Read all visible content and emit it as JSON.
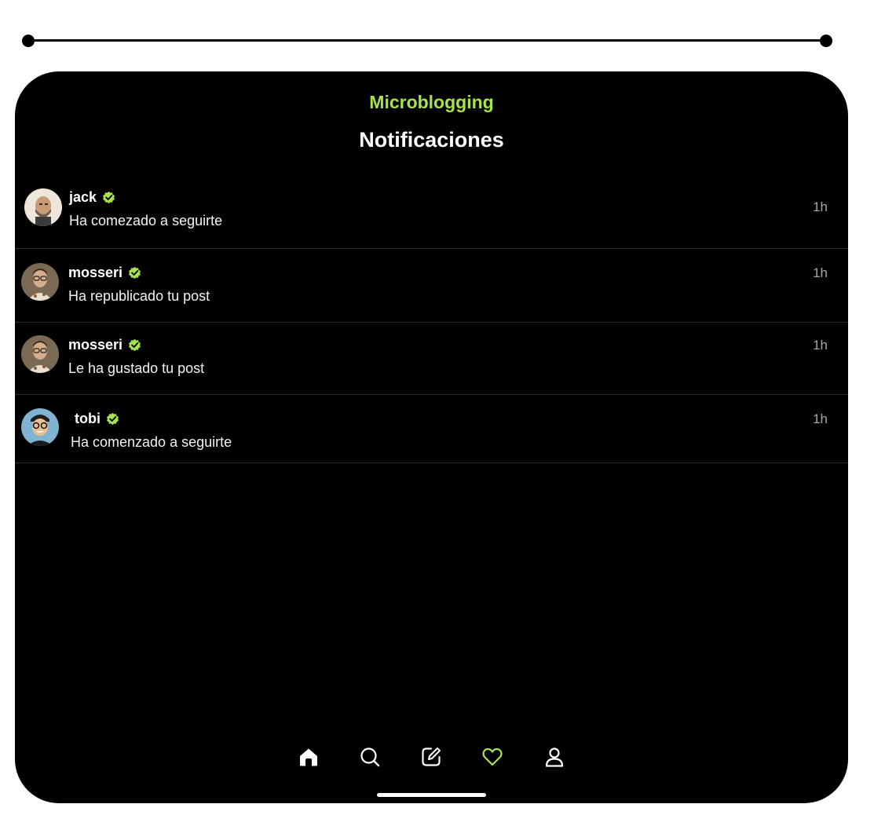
{
  "app": {
    "brand": "Microblogging",
    "title": "Notificaciones"
  },
  "colors": {
    "accent": "#a6e34f",
    "background": "#000000",
    "text": "#ffffff",
    "muted": "#a8a8a8"
  },
  "notifications": [
    {
      "username": "jack",
      "verified": true,
      "message": "Ha comezado a seguirte",
      "time": "1h",
      "avatar": "jack-avatar"
    },
    {
      "username": "mosseri",
      "verified": true,
      "message": "Ha republicado tu post",
      "time": "1h",
      "avatar": "mosseri-avatar"
    },
    {
      "username": "mosseri",
      "verified": true,
      "message": "Le ha gustado tu post",
      "time": "1h",
      "avatar": "mosseri-avatar"
    },
    {
      "username": "tobi",
      "verified": true,
      "message": "Ha comenzado a seguirte",
      "time": "1h",
      "avatar": "tobi-avatar"
    }
  ],
  "tabbar": {
    "items": [
      {
        "icon": "home-icon",
        "active": false
      },
      {
        "icon": "search-icon",
        "active": false
      },
      {
        "icon": "compose-icon",
        "active": false
      },
      {
        "icon": "heart-icon",
        "active": true
      },
      {
        "icon": "user-icon",
        "active": false
      }
    ]
  }
}
